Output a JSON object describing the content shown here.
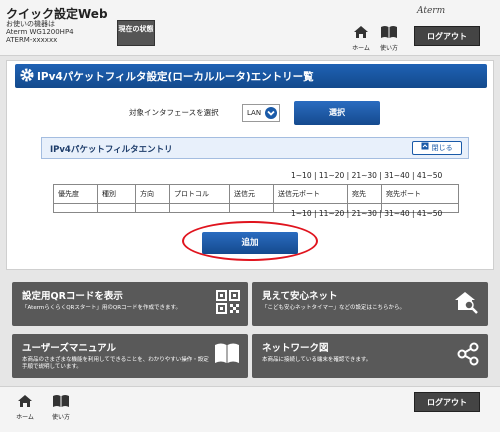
{
  "header": {
    "app_title": "クイック設定Web",
    "device_line1": "お使いの機器は",
    "device_line2": "Aterm WG1200HP4",
    "device_line3": "ATERM-xxxxxx",
    "status_button": "現在の状態",
    "home_label": "ホーム",
    "help_label": "使い方",
    "brand": "Aterm",
    "logout_label": "ログアウト"
  },
  "page": {
    "title": "IPv4パケットフィルタ設定(ローカルルータ)エントリー覧",
    "interface_label": "対象インタフェースを選択",
    "interface_value": "LAN",
    "select_button": "選択"
  },
  "entries_section": {
    "title": "IPv4パケットフィルタエントリ",
    "close_button": "閉じる",
    "pager": [
      "1~10",
      "11~20",
      "21~30",
      "31~40",
      "41~50"
    ],
    "columns": [
      "優先度",
      "種別",
      "方向",
      "プロトコル",
      "送信元",
      "送信元ポート",
      "宛先",
      "宛先ポート"
    ],
    "add_button": "追加"
  },
  "tiles": [
    {
      "title": "設定用QRコードを表示",
      "desc": "「AtermらくらくQRスタート」用のQRコードを作成できます。",
      "icon": "qr-code-icon"
    },
    {
      "title": "見えて安心ネット",
      "desc": "「こども安心ネットタイマー」などの設定はこちらから。",
      "icon": "home-search-icon"
    },
    {
      "title": "ユーザーズマニュアル",
      "desc": "本商品のさまざまな機能を利用してできることを、わかりやすい操作・設定手順で説明しています。",
      "icon": "book-icon"
    },
    {
      "title": "ネットワーク図",
      "desc": "本商品に接続している端末を確認できます。",
      "icon": "network-share-icon"
    }
  ],
  "footer": {
    "home_label": "ホーム",
    "help_label": "使い方",
    "logout_label": "ログアウト"
  },
  "colors": {
    "accent_blue": "#1a5aa8",
    "tile_gray": "#595959",
    "highlight_red": "#e0141e"
  }
}
